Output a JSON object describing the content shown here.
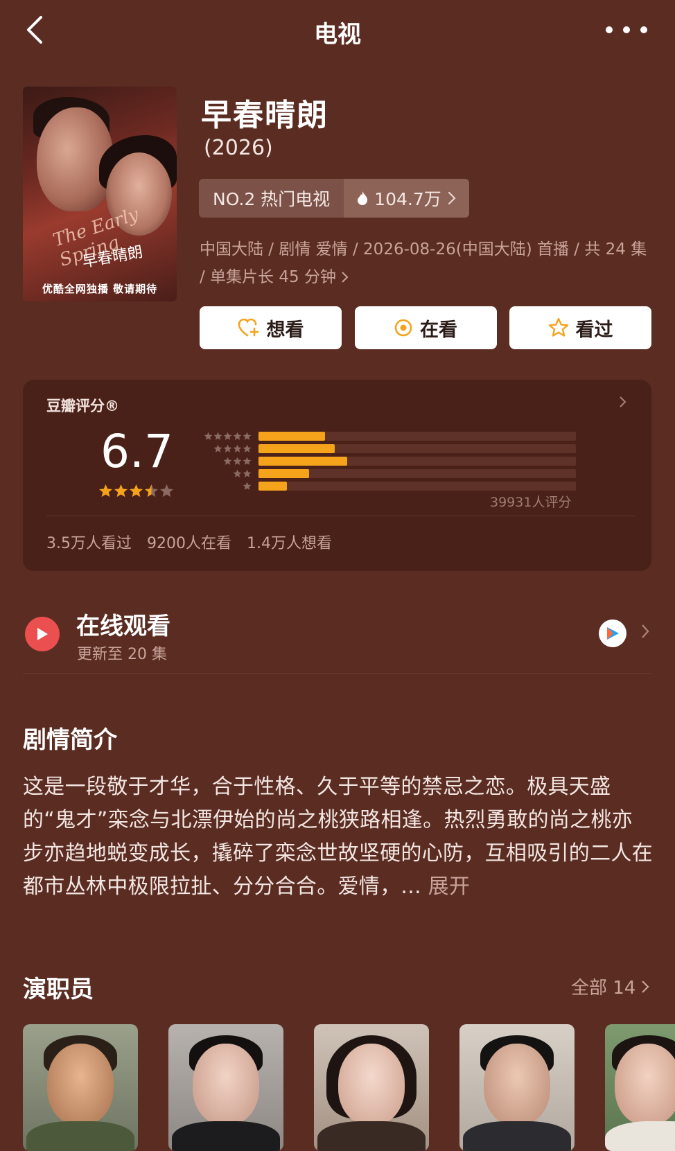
{
  "nav": {
    "title": "电视",
    "back_icon": "chevron-left-icon",
    "more_icon": "more-dots-icon"
  },
  "poster": {
    "script_en": "The Early Spring",
    "script_cn": "早春晴朗",
    "banner": "优酷全网独播 敬请期待"
  },
  "show": {
    "title": "早春晴朗",
    "year": "(2026)",
    "rank": "NO.2 热门电视",
    "heat": "104.7万",
    "meta": "中国大陆 / 剧情 爱情 / 2026-08-26(中国大陆) 首播 / 共 24 集 / 单集片长 45 分钟"
  },
  "actions": [
    {
      "label": "想看",
      "icon": "heart-plus-icon"
    },
    {
      "label": "在看",
      "icon": "watching-circle-icon"
    },
    {
      "label": "看过",
      "icon": "star-outline-icon"
    }
  ],
  "rating": {
    "label": "豆瓣评分®",
    "score": "6.7",
    "stars": 3.5,
    "distribution": [
      {
        "stars": 5,
        "fraction": 0.21
      },
      {
        "stars": 4,
        "fraction": 0.24
      },
      {
        "stars": 3,
        "fraction": 0.28
      },
      {
        "stars": 2,
        "fraction": 0.16
      },
      {
        "stars": 1,
        "fraction": 0.09
      }
    ],
    "count": "39931人评分",
    "stats": [
      "3.5万人看过",
      "9200人在看",
      "1.4万人想看"
    ],
    "colors": {
      "star": "#f6a31c",
      "track": "#5e3228"
    }
  },
  "online": {
    "title": "在线观看",
    "subtitle": "更新至 20 集",
    "provider_icon": "youku-icon"
  },
  "synopsis": {
    "title": "剧情简介",
    "text": "这是一段敬于才华，合于性格、久于平等的禁忌之恋。极具天盛的“鬼才”栾念与北漂伊始的尚之桃狭路相逢。热烈勇敢的尚之桃亦步亦趋地蜕变成长，撬碎了栾念世故坚硬的心防，互相吸引的二人在都市丛林中极限拉扯、分分合合。爱情，...",
    "more": " 展开"
  },
  "cast": {
    "title": "演职员",
    "all": "全部 14"
  }
}
